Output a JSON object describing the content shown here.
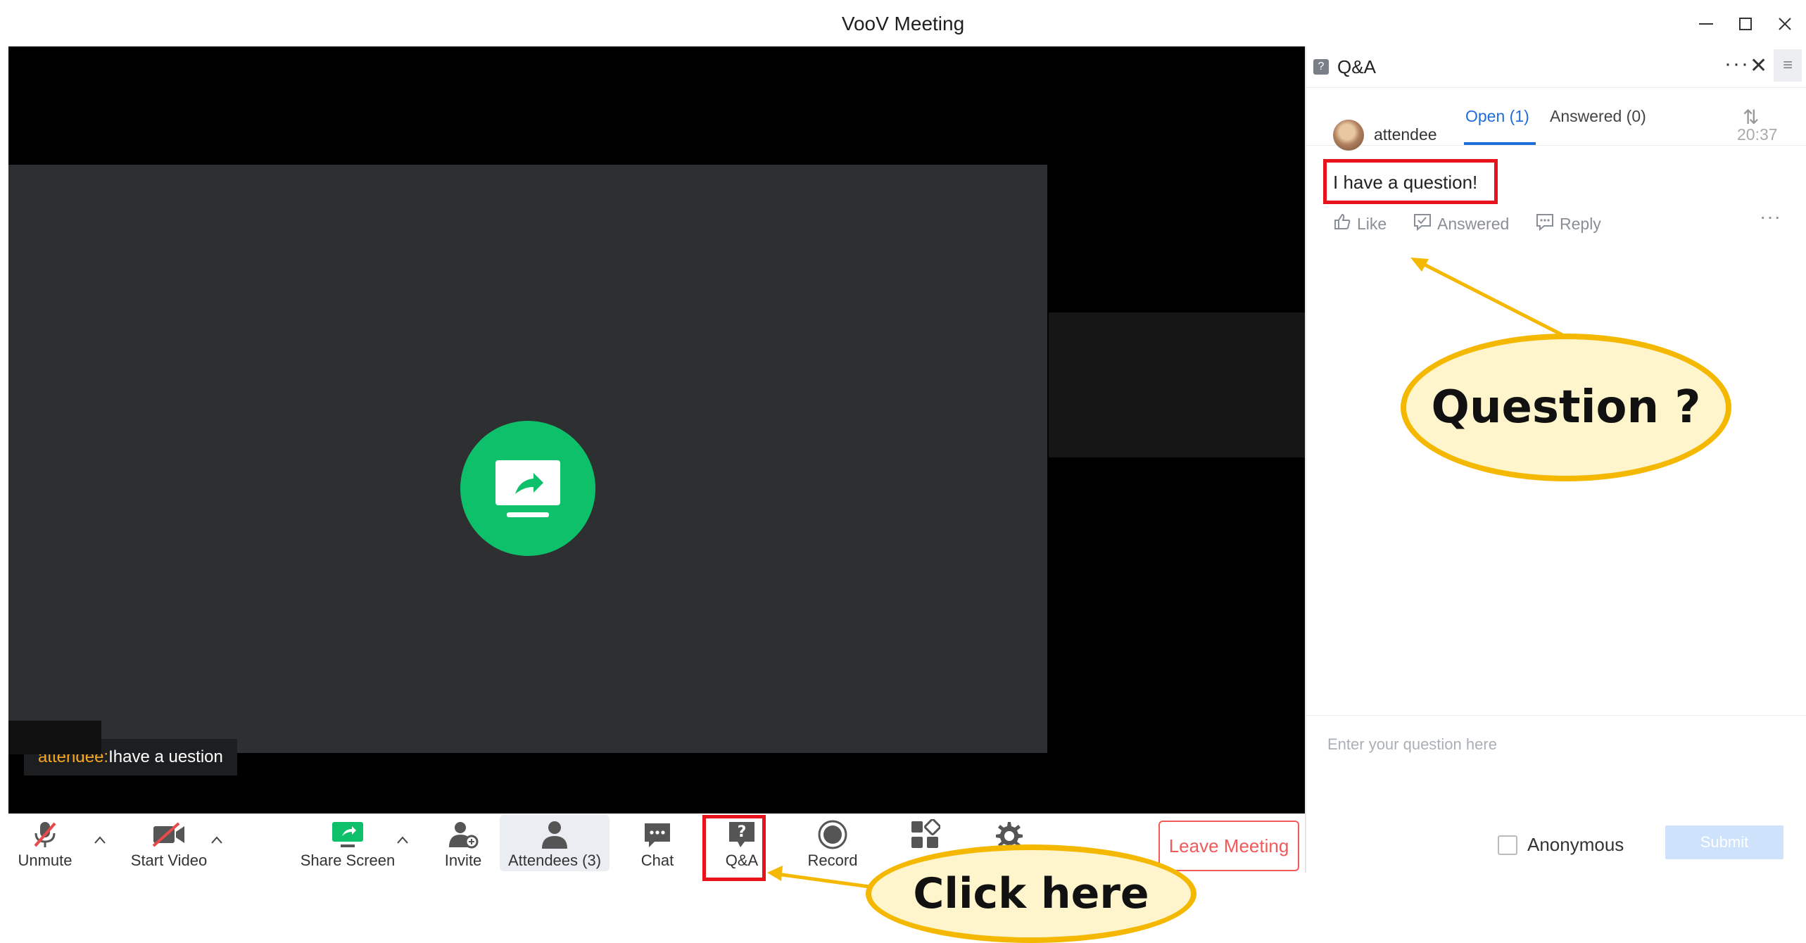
{
  "window": {
    "title": "VooV Meeting"
  },
  "video": {
    "caption_name": "attendee:",
    "caption_message": " Ihave a uestion"
  },
  "toolbar": {
    "unmute": "Unmute",
    "start_video": "Start Video",
    "share_screen": "Share Screen",
    "invite": "Invite",
    "attendees": "Attendees (3)",
    "chat": "Chat",
    "qa": "Q&A",
    "record": "Record",
    "leave_meeting": "Leave Meeting"
  },
  "qa_panel": {
    "title": "Q&A",
    "tabs": [
      {
        "label": "Open (1)",
        "active": true
      },
      {
        "label": "Answered (0)",
        "active": false
      }
    ],
    "questions": [
      {
        "author": "attendee",
        "time": "20:37",
        "text": "I have a question!",
        "actions": {
          "like": "Like",
          "answered": "Answered",
          "reply": "Reply"
        }
      }
    ],
    "input_placeholder": "Enter your question here",
    "anonymous_label": "Anonymous",
    "anonymous_checked": false,
    "submit_label": "Submit"
  },
  "annotations": {
    "question_callout": "Question ?",
    "click_callout": "Click here"
  },
  "colors": {
    "accent_blue": "#1e6fd9",
    "share_green": "#0fc06b",
    "leave_red": "#f05a5a",
    "highlight_red": "#e8131b",
    "callout_yellow": "#f5b800"
  }
}
